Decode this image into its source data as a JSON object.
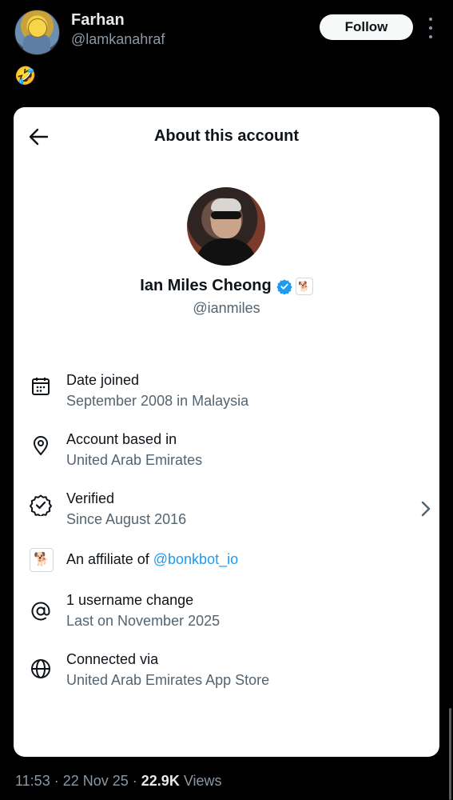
{
  "post": {
    "author_name": "Farhan",
    "author_handle": "@lamkanahraf",
    "follow_label": "Follow",
    "emoji": "🤣"
  },
  "card": {
    "title": "About this account",
    "account_name": "Ian Miles Cheong",
    "account_handle": "@ianmiles",
    "rows": [
      {
        "label": "Date joined",
        "sub": "September 2008 in Malaysia"
      },
      {
        "label": "Account based in",
        "sub": "United Arab Emirates"
      },
      {
        "label": "Verified",
        "sub": "Since August 2016"
      },
      {
        "label_prefix": "An affiliate of ",
        "label_link": "@bonkbot_io"
      },
      {
        "label": "1 username change",
        "sub": "Last on November 2025"
      },
      {
        "label": "Connected via",
        "sub": "United Arab Emirates App Store"
      }
    ]
  },
  "footer": {
    "time": "11:53",
    "date": "22 Nov 25",
    "views_count": "22.9K",
    "views_label": "Views"
  },
  "colors": {
    "verified_blue": "#1d9bf0",
    "background": "#000000",
    "card": "#ffffff"
  }
}
